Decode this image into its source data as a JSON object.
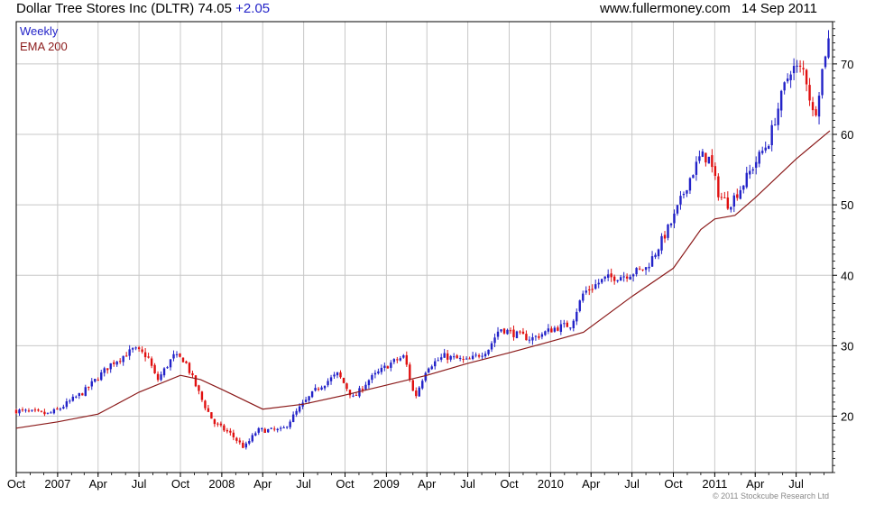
{
  "header": {
    "title": "Dollar Tree Stores Inc (DLTR)",
    "price": "74.05",
    "change": "+2.05",
    "site": "www.fullermoney.com",
    "date": "14 Sep 2011"
  },
  "copyright": "© 2011 Stockcube Research Ltd",
  "colors": {
    "up": "#2323c8",
    "down": "#e01010",
    "ema": "#8b1a1a",
    "grid": "#c8c8c8",
    "frame": "#000000"
  },
  "chart_data": {
    "type": "line",
    "frequency": "weekly",
    "style": "candlestick",
    "grid": true,
    "legend_position": "top-left",
    "ylim": [
      12,
      76
    ],
    "yticks": [
      20,
      30,
      40,
      50,
      60,
      70
    ],
    "ytick_labels": [
      "20",
      "30",
      "40",
      "50",
      "60",
      "70"
    ],
    "xlim": [
      "2006-10-01",
      "2011-09-20"
    ],
    "xticks": [
      "2006-10-01",
      "2007-01-01",
      "2007-04-01",
      "2007-07-01",
      "2007-10-01",
      "2008-01-01",
      "2008-04-01",
      "2008-07-01",
      "2008-10-01",
      "2009-01-01",
      "2009-04-01",
      "2009-07-01",
      "2009-10-01",
      "2010-01-01",
      "2010-04-01",
      "2010-07-01",
      "2010-10-01",
      "2011-01-01",
      "2011-04-01",
      "2011-07-01"
    ],
    "xtick_labels": [
      "Oct",
      "2007",
      "Apr",
      "Jul",
      "Oct",
      "2008",
      "Apr",
      "Jul",
      "Oct",
      "2009",
      "Apr",
      "Jul",
      "Oct",
      "2010",
      "Apr",
      "Jul",
      "Oct",
      "2011",
      "Apr",
      "Jul"
    ],
    "series": [
      {
        "name": "Weekly",
        "points": [
          [
            "2006-10-01",
            20.8
          ],
          [
            "2006-12-10",
            20.3
          ],
          [
            "2006-12-30",
            20.8
          ],
          [
            "2007-03-01",
            23.5
          ],
          [
            "2007-05-01",
            27.5
          ],
          [
            "2007-06-20",
            29.5
          ],
          [
            "2007-07-20",
            28.5
          ],
          [
            "2007-08-10",
            25.0
          ],
          [
            "2007-09-15",
            28.5
          ],
          [
            "2007-10-10",
            28.0
          ],
          [
            "2007-11-20",
            22.0
          ],
          [
            "2007-12-15",
            19.0
          ],
          [
            "2008-01-20",
            17.5
          ],
          [
            "2008-02-20",
            15.5
          ],
          [
            "2008-03-20",
            18.0
          ],
          [
            "2008-05-15",
            18.0
          ],
          [
            "2008-06-20",
            21.0
          ],
          [
            "2008-08-01",
            24.0
          ],
          [
            "2008-09-15",
            26.0
          ],
          [
            "2008-10-20",
            22.5
          ],
          [
            "2008-11-20",
            25.0
          ],
          [
            "2009-01-10",
            27.5
          ],
          [
            "2009-02-10",
            28.5
          ],
          [
            "2009-03-05",
            22.5
          ],
          [
            "2009-04-01",
            27.0
          ],
          [
            "2009-05-10",
            28.5
          ],
          [
            "2009-07-01",
            27.8
          ],
          [
            "2009-08-15",
            29.5
          ],
          [
            "2009-09-10",
            32.5
          ],
          [
            "2009-10-20",
            31.5
          ],
          [
            "2009-11-20",
            31.0
          ],
          [
            "2010-01-10",
            32.5
          ],
          [
            "2010-02-15",
            33.0
          ],
          [
            "2010-03-15",
            37.5
          ],
          [
            "2010-05-01",
            39.5
          ],
          [
            "2010-06-15",
            40.0
          ],
          [
            "2010-08-01",
            41.0
          ],
          [
            "2010-08-20",
            43.0
          ],
          [
            "2010-10-01",
            48.0
          ],
          [
            "2010-11-01",
            53.0
          ],
          [
            "2010-12-01",
            57.0
          ],
          [
            "2010-12-20",
            56.5
          ],
          [
            "2011-01-10",
            51.5
          ],
          [
            "2011-02-01",
            50.0
          ],
          [
            "2011-03-01",
            52.5
          ],
          [
            "2011-04-01",
            56.0
          ],
          [
            "2011-05-01",
            59.0
          ],
          [
            "2011-06-01",
            66.0
          ],
          [
            "2011-06-20",
            69.5
          ],
          [
            "2011-07-20",
            69.0
          ],
          [
            "2011-08-10",
            62.0
          ],
          [
            "2011-08-25",
            68.0
          ],
          [
            "2011-09-05",
            72.0
          ],
          [
            "2011-09-14",
            74.0
          ]
        ]
      },
      {
        "name": "EMA 200",
        "points": [
          [
            "2006-10-01",
            18.3
          ],
          [
            "2007-01-01",
            19.2
          ],
          [
            "2007-04-01",
            20.3
          ],
          [
            "2007-07-01",
            23.4
          ],
          [
            "2007-10-01",
            25.8
          ],
          [
            "2007-11-15",
            25.2
          ],
          [
            "2008-01-01",
            23.8
          ],
          [
            "2008-04-01",
            21.0
          ],
          [
            "2008-07-01",
            21.7
          ],
          [
            "2008-10-01",
            23.0
          ],
          [
            "2009-01-01",
            24.4
          ],
          [
            "2009-04-01",
            25.8
          ],
          [
            "2009-07-01",
            27.5
          ],
          [
            "2009-10-01",
            29.0
          ],
          [
            "2010-01-01",
            30.6
          ],
          [
            "2010-03-15",
            31.9
          ],
          [
            "2010-07-01",
            37.0
          ],
          [
            "2010-10-01",
            41.0
          ],
          [
            "2010-12-01",
            46.5
          ],
          [
            "2011-01-01",
            48.0
          ],
          [
            "2011-02-15",
            48.5
          ],
          [
            "2011-04-01",
            51.0
          ],
          [
            "2011-07-01",
            56.5
          ],
          [
            "2011-09-14",
            60.5
          ]
        ]
      }
    ]
  }
}
